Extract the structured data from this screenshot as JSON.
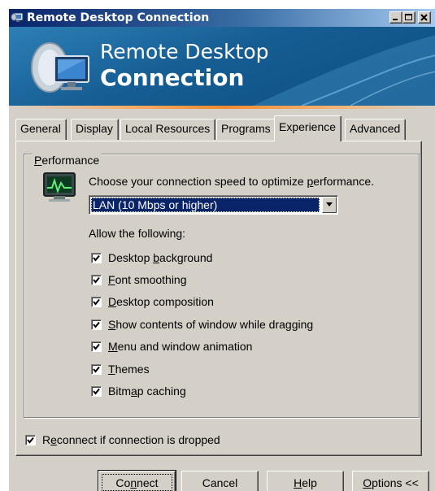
{
  "window": {
    "title": "Remote Desktop Connection",
    "accent": "#0a246a",
    "face_color": "#d4d0c8"
  },
  "banner": {
    "line1": "Remote Desktop",
    "line2": "Connection",
    "colors": [
      "#155d93",
      "#f08a30"
    ]
  },
  "tabs": [
    {
      "label": "General",
      "selected": false
    },
    {
      "label": "Display",
      "selected": false
    },
    {
      "label": "Local Resources",
      "selected": false
    },
    {
      "label": "Programs",
      "selected": false
    },
    {
      "label": "Experience",
      "selected": true
    },
    {
      "label": "Advanced",
      "selected": false
    }
  ],
  "performance": {
    "group_label": "Performance",
    "mnemonic_index": 0,
    "icon": "performance-monitor-icon",
    "prompt": "Choose your connection speed to optimize performance.",
    "speed_select": {
      "value": "LAN (10 Mbps or higher)"
    },
    "allow_label": "Allow the following:",
    "options": [
      {
        "label": "Desktop background",
        "checked": true
      },
      {
        "label": "Font smoothing",
        "checked": true
      },
      {
        "label": "Desktop composition",
        "checked": true
      },
      {
        "label": "Show contents of window while dragging",
        "checked": true
      },
      {
        "label": "Menu and window animation",
        "checked": true
      },
      {
        "label": "Themes",
        "checked": true
      },
      {
        "label": "Bitmap caching",
        "checked": true
      }
    ]
  },
  "reconnect": {
    "label": "Reconnect if connection is dropped",
    "checked": true
  },
  "buttons": {
    "connect": "Connect",
    "cancel": "Cancel",
    "help": "Help",
    "options": "Options <<"
  }
}
